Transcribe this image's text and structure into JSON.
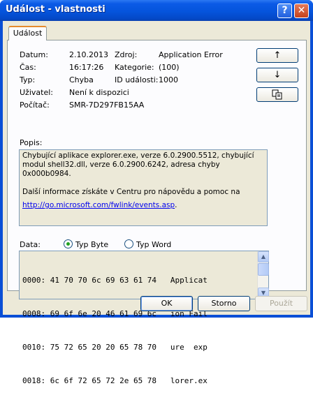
{
  "window": {
    "title": "Událost - vlastnosti"
  },
  "title_buttons": {
    "help": "?",
    "close": "✕"
  },
  "tabs": [
    {
      "label": "Událost"
    }
  ],
  "fields": {
    "date": {
      "label": "Datum:",
      "value": "2.10.2013"
    },
    "time": {
      "label": "Čas:",
      "value": "16:17:26"
    },
    "type": {
      "label": "Typ:",
      "value": "Chyba"
    },
    "user": {
      "label": "Uživatel:",
      "value": "Není k dispozici"
    },
    "computer": {
      "label": "Počítač:",
      "value": "SMR-7D297FB15AA"
    },
    "source": {
      "label": "Zdroj:",
      "value": "Application Error"
    },
    "category": {
      "label": "Kategorie:",
      "value": "(100)"
    },
    "event_id": {
      "label": "ID události:",
      "value": "1000"
    }
  },
  "nav_buttons": {
    "up": "↑",
    "down": "↓",
    "copy": "copy"
  },
  "description": {
    "label": "Popis:",
    "line1": "Chybující aplikace explorer.exe, verze 6.0.2900.5512, chybující modul shell32.dll, verze 6.0.2900.6242, adresa chyby 0x000b0984.",
    "line2": "Další informace získáte v Centru pro nápovědu a pomoc na",
    "link": "http://go.microsoft.com/fwlink/events.asp",
    "link_suffix": "."
  },
  "data_section": {
    "label": "Data:",
    "radio_byte": {
      "label": "Typ Byte",
      "selected": true
    },
    "radio_word": {
      "label": "Typ Word",
      "selected": false
    },
    "lines": [
      "0000: 41 70 70 6c 69 63 61 74   Applicat",
      "0008: 69 6f 6e 20 46 61 69 6c   ion Fail",
      "0010: 75 72 65 20 20 65 78 70   ure  exp",
      "0018: 6c 6f 72 65 72 2e 65 78   lorer.ex"
    ]
  },
  "buttons": {
    "ok": "OK",
    "cancel": "Storno",
    "apply": "Použít"
  }
}
